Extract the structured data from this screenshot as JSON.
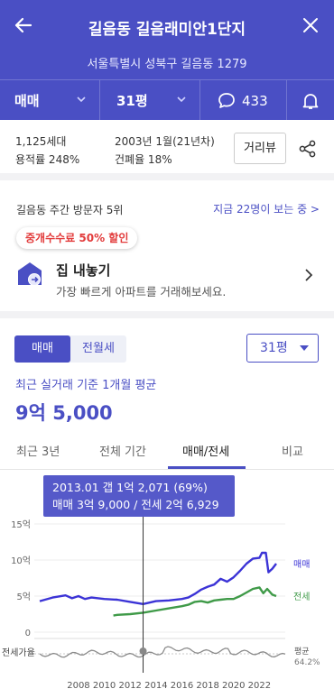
{
  "header": {
    "title": "길음동 길음래미안1단지",
    "address": "서울특별시 성북구 길음동 1279",
    "trade_type": "매매",
    "size": "31평",
    "comment_count": "433"
  },
  "info": {
    "households": "1,125세대",
    "floor_area_ratio": "용적률 248%",
    "built": "2003년 1월(21년차)",
    "coverage_ratio": "건폐율 18%",
    "street_view_button": "거리뷰"
  },
  "visitor": {
    "rank": "길음동 주간 방문자 5위",
    "viewing_now": "지금 22명이 보는 중 >"
  },
  "promo": {
    "badge": "중개수수료 50% 할인",
    "title": "집 내놓기",
    "subtitle": "가장 빠르게 아파트를 거래해보세요."
  },
  "controls": {
    "toggle": [
      "매매",
      "전월세"
    ],
    "size_select": "31평"
  },
  "summary": {
    "label": "최근 실거래 기준 1개월 평균",
    "price": "9억 5,000"
  },
  "tabs": [
    "최근 3년",
    "전체 기간",
    "매매/전세",
    "비교"
  ],
  "tooltip": {
    "line1": "2013.01  갭 1억 2,071 (69%)",
    "line2": "매매 3억 9,000 / 전세 2억 6,929"
  },
  "colors": {
    "brand": "#4a4fc4",
    "sale_line": "#3b33d6",
    "jeonse_line": "#3f9a48",
    "ratio_line": "#8a8a8a"
  },
  "chart_data": {
    "type": "line",
    "ylim": [
      0,
      15
    ],
    "y_ticks": [
      "15억",
      "10억",
      "5억",
      "0"
    ],
    "x_ticks": [
      "2008",
      "2010",
      "2012",
      "2014",
      "2016",
      "2018",
      "2020",
      "2022"
    ],
    "series": [
      {
        "name": "매매",
        "x": [
          2005.0,
          2006.0,
          2007.0,
          2007.5,
          2008.0,
          2008.5,
          2009.0,
          2010.0,
          2011.0,
          2012.0,
          2013.0,
          2013.5,
          2014.0,
          2015.0,
          2016.0,
          2016.5,
          2017.0,
          2017.5,
          2018.0,
          2018.5,
          2019.0,
          2019.5,
          2020.0,
          2020.5,
          2021.0,
          2021.5,
          2022.0,
          2022.2,
          2022.5,
          2022.7,
          2023.0,
          2023.3
        ],
        "values": [
          4.3,
          4.8,
          5.1,
          4.7,
          5.0,
          4.6,
          4.8,
          4.6,
          4.5,
          4.2,
          3.9,
          4.1,
          4.3,
          4.4,
          4.6,
          4.8,
          5.3,
          5.9,
          6.3,
          6.6,
          7.4,
          7.0,
          7.6,
          8.5,
          9.5,
          10.2,
          10.3,
          11.0,
          11.0,
          8.3,
          8.8,
          9.5
        ]
      },
      {
        "name": "전세",
        "x": [
          2010.7,
          2011.0,
          2012.0,
          2013.0,
          2014.0,
          2015.0,
          2016.0,
          2016.5,
          2017.0,
          2017.5,
          2018.0,
          2018.5,
          2019.0,
          2019.5,
          2020.0,
          2020.5,
          2021.0,
          2021.5,
          2022.0,
          2022.3,
          2022.6,
          2023.0,
          2023.3
        ],
        "values": [
          2.3,
          2.4,
          2.5,
          2.7,
          3.0,
          3.3,
          3.6,
          3.8,
          4.2,
          4.3,
          4.1,
          4.4,
          4.5,
          4.6,
          4.6,
          5.0,
          5.5,
          6.0,
          6.2,
          5.4,
          6.0,
          5.2,
          5.0
        ]
      }
    ],
    "ratio": {
      "label": "전세가율",
      "last_label": "평균",
      "last_value": "64.2%"
    },
    "cursor_x": 2013.0
  }
}
